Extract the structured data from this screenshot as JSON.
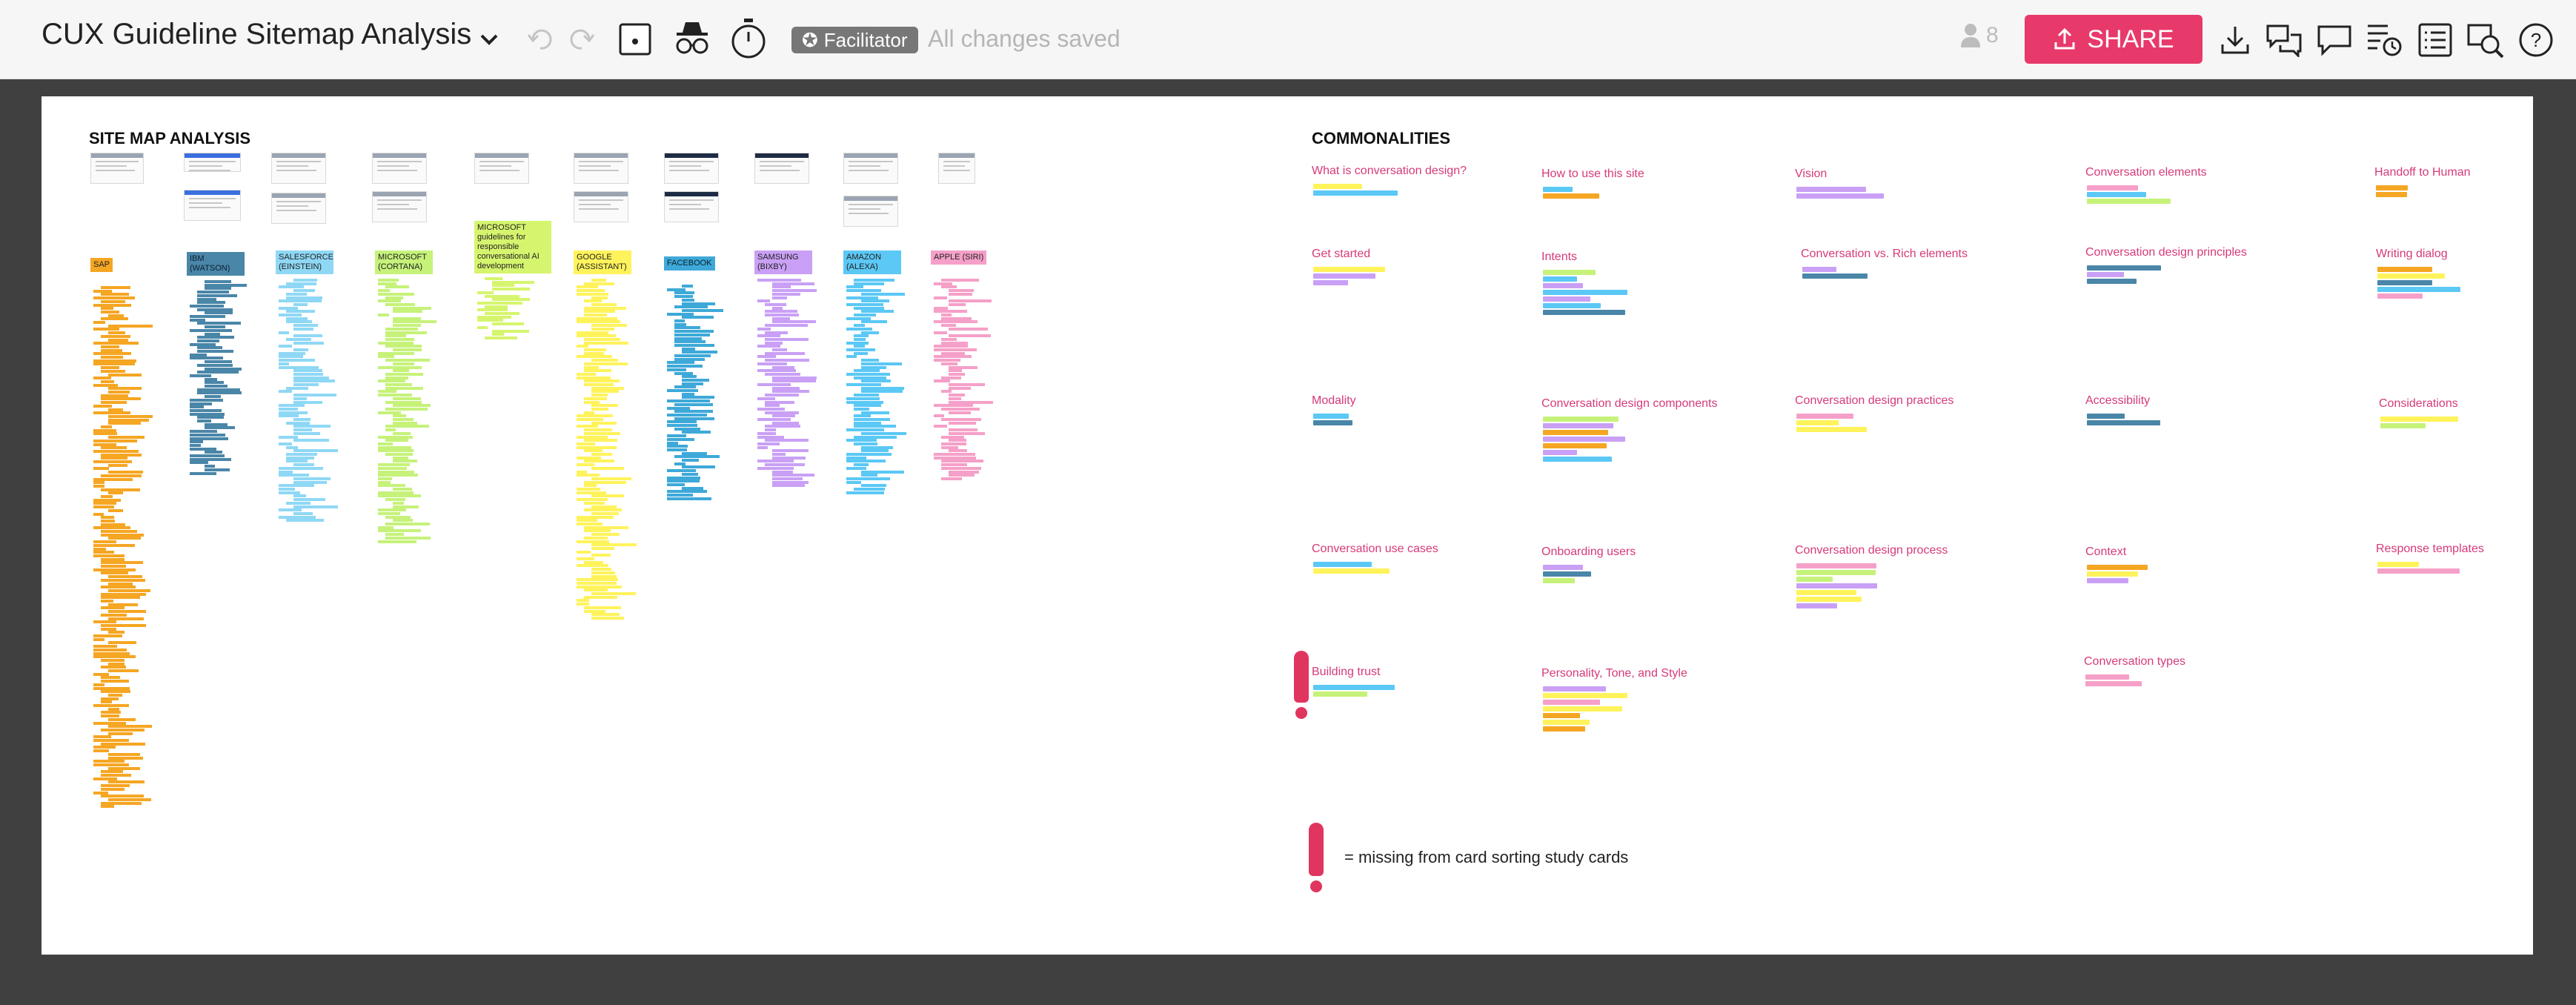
{
  "header": {
    "board_title": "CUX Guideline Sitemap Analysis",
    "facilitator_label": "Facilitator",
    "save_status": "All changes saved",
    "users_count": "8",
    "share_label": "SHARE"
  },
  "colors": {
    "share": "#e8396b",
    "accent_pink": "#d63a7a",
    "sticky_orange": "#f5a623",
    "sticky_yellow": "#fff35c",
    "sticky_blue": "#5bc8f5",
    "sticky_green": "#c6f27a",
    "sticky_purple": "#c9a0f5",
    "sticky_pink": "#f5a0c8"
  },
  "icons": [
    "chevron-down-icon",
    "undo-icon",
    "redo-icon",
    "sticky-note-icon",
    "incognito-icon",
    "timer-icon",
    "star-icon",
    "user-icon",
    "upload-icon",
    "download-icon",
    "comments-icon",
    "comment-icon",
    "activity-icon",
    "outline-icon",
    "search-icon",
    "help-icon"
  ],
  "board": {
    "sitemap_title": "SITE MAP ANALYSIS",
    "commonalities_title": "COMMONALITIES",
    "columns": [
      {
        "label": "SAP",
        "color": "#f5a623"
      },
      {
        "label": "IBM (WATSON)",
        "color": "#4a86a8"
      },
      {
        "label": "SALESFORCE (EINSTEIN)",
        "color": "#8fd8f5"
      },
      {
        "label": "MICROSOFT (CORTANA)",
        "color": "#c6f27a"
      },
      {
        "label": "MICROSOFT guidelines for responsible conversational AI development",
        "color": "#d6f56e"
      },
      {
        "label": "GOOGLE (ASSISTANT)",
        "color": "#fff35c"
      },
      {
        "label": "FACEBOOK",
        "color": "#3ea9d8"
      },
      {
        "label": "SAMSUNG (BIXBY)",
        "color": "#c9a0f5"
      },
      {
        "label": "AMAZON (ALEXA)",
        "color": "#5bc8f5"
      },
      {
        "label": "APPLE (SIRI)",
        "color": "#f5a0c8"
      }
    ],
    "categories": [
      "What is conversation design?",
      "How to use this site",
      "Vision",
      "Conversation elements",
      "Handoff to Human",
      "Get started",
      "Intents",
      "Conversation vs. Rich elements",
      "Conversation design principles",
      "Writing dialog",
      "Modality",
      "Conversation design components",
      "Conversation design practices",
      "Accessibility",
      "Considerations",
      "Conversation use cases",
      "Onboarding users",
      "Conversation design process",
      "Context",
      "Response templates",
      "Building trust",
      "Personality, Tone, and Style",
      "Conversation types"
    ],
    "legend": "= missing from card sorting study cards"
  }
}
